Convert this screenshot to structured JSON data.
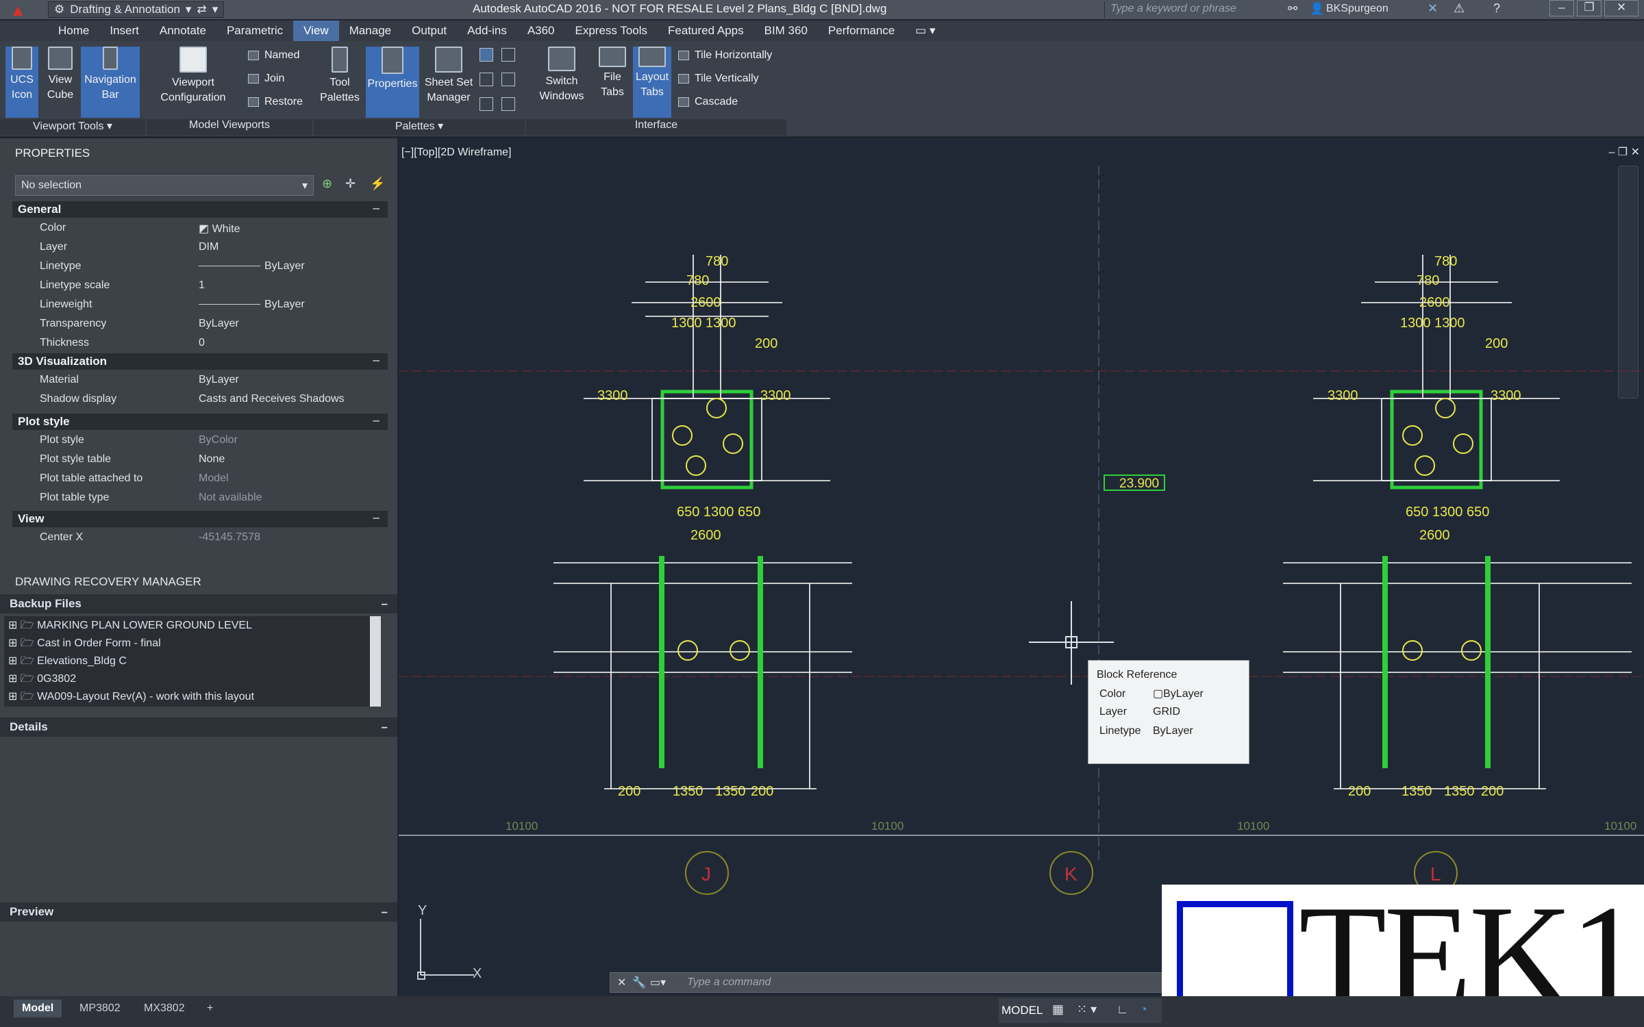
{
  "titlebar": {
    "workspace": "Drafting & Annotation",
    "doc_title": "Autodesk AutoCAD 2016 - NOT FOR RESALE     Level 2 Plans_Bldg C [BND].dwg",
    "search_placeholder": "Type a keyword or phrase",
    "user": "BKSpurgeon"
  },
  "menubar": {
    "items": [
      "Home",
      "Insert",
      "Annotate",
      "Parametric",
      "View",
      "Manage",
      "Output",
      "Add-ins",
      "A360",
      "Express Tools",
      "Featured Apps",
      "BIM 360",
      "Performance"
    ],
    "active": "View"
  },
  "ribbon": {
    "ucs_icon": "UCS\nIcon",
    "view_cube": "View\nCube",
    "navigation_bar": "Navigation\nBar",
    "viewport_config": "Viewport\nConfiguration",
    "named": "Named",
    "join": "Join",
    "restore": "Restore",
    "tool_palettes": "Tool\nPalettes",
    "properties": "Properties",
    "sheet_set": "Sheet Set\nManager",
    "switch_windows": "Switch\nWindows",
    "file_tabs": "File\nTabs",
    "layout_tabs": "Layout\nTabs",
    "tile_h": "Tile Horizontally",
    "tile_v": "Tile Vertically",
    "cascade": "Cascade",
    "panel_viewport_tools": "Viewport Tools",
    "panel_model_viewports": "Model Viewports",
    "panel_palettes": "Palettes",
    "panel_interface": "Interface"
  },
  "properties": {
    "title": "PROPERTIES",
    "selection": "No selection",
    "sections": {
      "general": "General",
      "viz": "3D Visualization",
      "plot": "Plot style",
      "view": "View"
    },
    "rows": [
      {
        "k": "Color",
        "v": "White"
      },
      {
        "k": "Layer",
        "v": "DIM"
      },
      {
        "k": "Linetype",
        "v": "ByLayer"
      },
      {
        "k": "Linetype scale",
        "v": "1"
      },
      {
        "k": "Lineweight",
        "v": "ByLayer"
      },
      {
        "k": "Transparency",
        "v": "ByLayer"
      },
      {
        "k": "Thickness",
        "v": "0"
      },
      {
        "k": "Material",
        "v": "ByLayer"
      },
      {
        "k": "Shadow display",
        "v": "Casts and Receives Shadows"
      },
      {
        "k": "Plot style",
        "v": "ByColor"
      },
      {
        "k": "Plot style table",
        "v": "None"
      },
      {
        "k": "Plot table attached to",
        "v": "Model"
      },
      {
        "k": "Plot table type",
        "v": "Not available"
      },
      {
        "k": "Center X",
        "v": "-45145.7578"
      }
    ]
  },
  "recovery": {
    "title": "DRAWING RECOVERY MANAGER",
    "backup_title": "Backup Files",
    "files": [
      "MARKING PLAN LOWER GROUND LEVEL",
      "Cast in Order Form - final",
      "Elevations_Bldg C",
      "0G3802",
      "WA009-Layout Rev(A) - work with this layout"
    ],
    "details": "Details",
    "preview": "Preview"
  },
  "viewport": {
    "label": "[−][Top][2D Wireframe]",
    "elevation": "23.900",
    "grid_j": "J",
    "grid_k": "K",
    "grid_l": "L",
    "spacing": "10100"
  },
  "tooltip": {
    "title": "Block Reference",
    "color_k": "Color",
    "color_v": "ByLayer",
    "layer_k": "Layer",
    "layer_v": "GRID",
    "linetype_k": "Linetype",
    "linetype_v": "ByLayer"
  },
  "command": {
    "placeholder": "Type a command"
  },
  "status": {
    "tabs": [
      "Model",
      "MP3802",
      "MX3802"
    ],
    "model": "MODEL"
  },
  "watermark": "TEK1",
  "colors": {
    "accent": "#4a6fa3",
    "dim_yellow": "#e8e84a",
    "green": "#2fcf3a",
    "magenta": "#d44fd4"
  }
}
